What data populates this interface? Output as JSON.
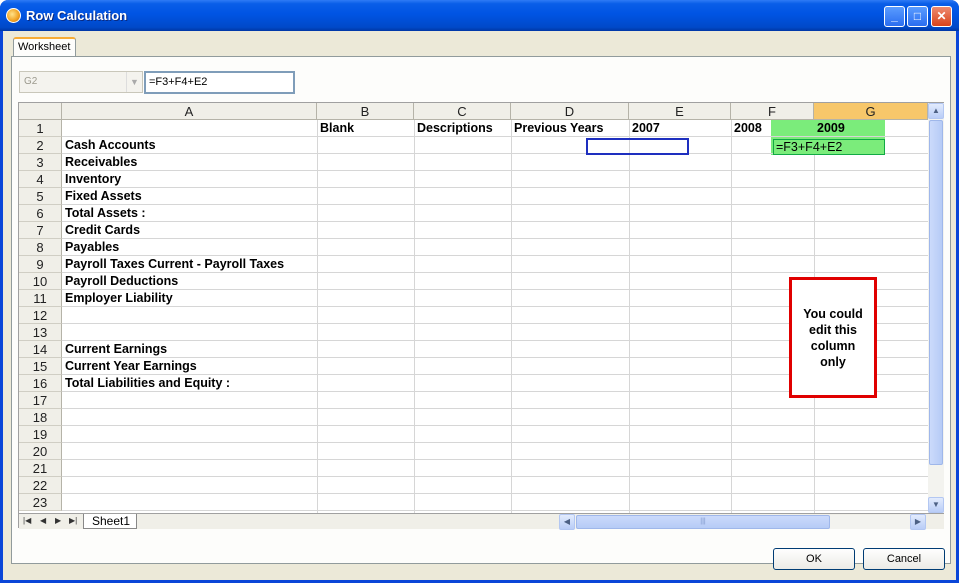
{
  "window": {
    "title": "Row Calculation",
    "controls": {
      "minimize": "_",
      "maximize": "□",
      "close": "✕"
    }
  },
  "tab": {
    "label": "Worksheet"
  },
  "formula_bar": {
    "cell_ref": "G2",
    "formula": "=F3+F4+E2"
  },
  "columns": [
    {
      "key": "A",
      "label": "A"
    },
    {
      "key": "B",
      "label": "B"
    },
    {
      "key": "C",
      "label": "C"
    },
    {
      "key": "D",
      "label": "D"
    },
    {
      "key": "E",
      "label": "E"
    },
    {
      "key": "F",
      "label": "F"
    },
    {
      "key": "G",
      "label": "G",
      "selected": true
    }
  ],
  "rows": [
    {
      "num": "1",
      "A": "",
      "B": "Blank",
      "C": "Descriptions",
      "D": "Previous Years",
      "E": "2007",
      "F": "2008",
      "G": "2009"
    },
    {
      "num": "2",
      "A": "Cash Accounts",
      "G": "=F3+F4+E2"
    },
    {
      "num": "3",
      "A": "Receivables"
    },
    {
      "num": "4",
      "A": "Inventory"
    },
    {
      "num": "5",
      "A": "Fixed Assets"
    },
    {
      "num": "6",
      "A": "Total Assets :"
    },
    {
      "num": "7",
      "A": "Credit Cards"
    },
    {
      "num": "8",
      "A": "Payables"
    },
    {
      "num": "9",
      "A": "Payroll Taxes Current - Payroll Taxes"
    },
    {
      "num": "10",
      "A": "Payroll Deductions"
    },
    {
      "num": "11",
      "A": "Employer Liability"
    },
    {
      "num": "12",
      "A": ""
    },
    {
      "num": "13",
      "A": ""
    },
    {
      "num": "14",
      "A": "Current Earnings"
    },
    {
      "num": "15",
      "A": "Current Year Earnings"
    },
    {
      "num": "16",
      "A": "Total Liabilities and Equity :"
    },
    {
      "num": "17"
    },
    {
      "num": "18"
    },
    {
      "num": "19"
    },
    {
      "num": "20"
    },
    {
      "num": "21"
    },
    {
      "num": "22"
    },
    {
      "num": "23"
    }
  ],
  "note": {
    "lines": [
      "You could",
      "edit this",
      "column",
      "only"
    ]
  },
  "sheet_tab": "Sheet1",
  "buttons": {
    "ok": "OK",
    "cancel": "Cancel"
  }
}
